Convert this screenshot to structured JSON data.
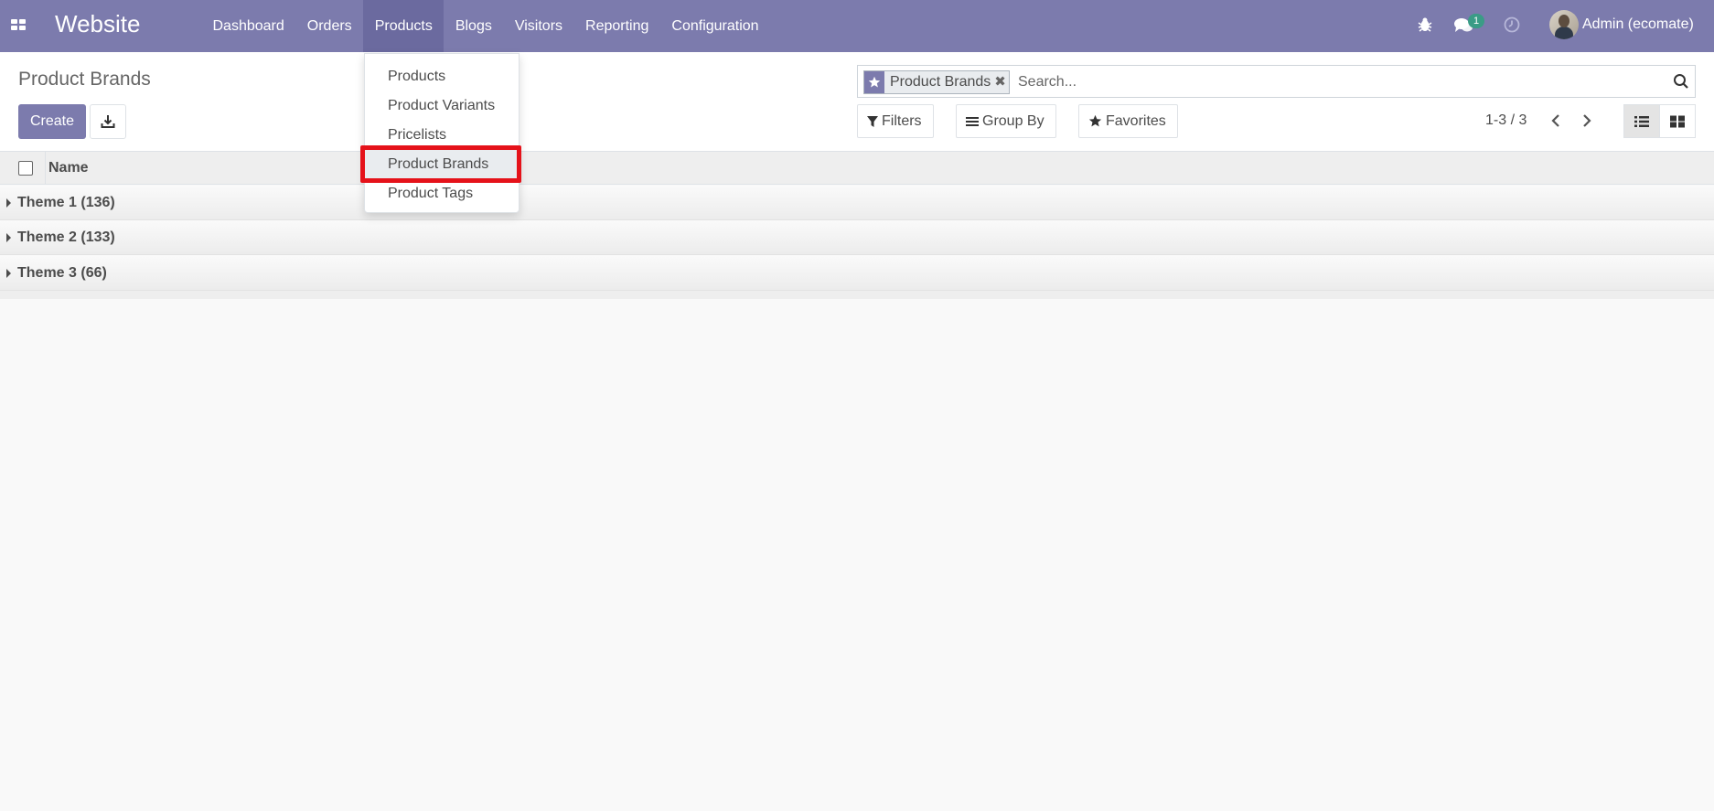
{
  "navbar": {
    "brand": "Website",
    "apps_icon": "apps-grid-icon",
    "menu": [
      "Dashboard",
      "Orders",
      "Products",
      "Blogs",
      "Visitors",
      "Reporting",
      "Configuration"
    ],
    "active_menu": "Products",
    "chat_badge": "1",
    "user": "Admin (ecomate)",
    "color": "#7c7bad"
  },
  "products_dropdown": {
    "items": [
      "Products",
      "Product Variants",
      "Pricelists",
      "Product Brands",
      "Product Tags"
    ],
    "highlighted": "Product Brands",
    "highlight_color": "#e5121a"
  },
  "control_panel": {
    "title": "Product Brands",
    "create_label": "Create",
    "download_icon": "download-icon",
    "search": {
      "facet_label": "Product Brands",
      "facet_icon": "star-icon",
      "placeholder": "Search..."
    },
    "filters_label": "Filters",
    "group_by_label": "Group By",
    "favorites_label": "Favorites",
    "pager": "1-3 / 3"
  },
  "list": {
    "columns": [
      "Name"
    ],
    "groups": [
      "Theme 1 (136)",
      "Theme 2 (133)",
      "Theme 3 (66)"
    ]
  }
}
